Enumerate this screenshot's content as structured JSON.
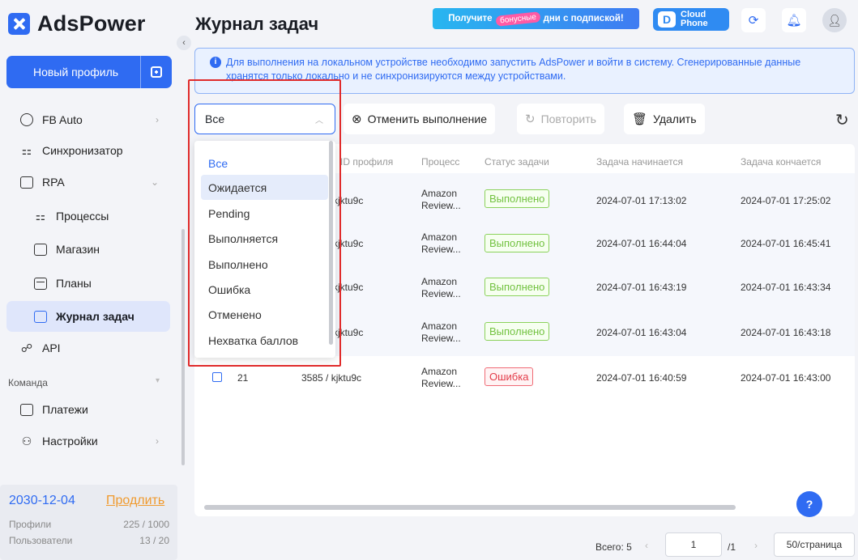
{
  "app": {
    "brand": "AdsPower"
  },
  "sidebar": {
    "new_profile": "Новый профиль",
    "items": [
      {
        "label": "FB Auto",
        "icon": "fb-auto-icon"
      },
      {
        "label": "Синхронизатор",
        "icon": "sync-icon"
      },
      {
        "label": "RPA",
        "icon": "robot-icon"
      },
      {
        "label": "Процессы",
        "icon": "flow-icon"
      },
      {
        "label": "Магазин",
        "icon": "shop-icon"
      },
      {
        "label": "Планы",
        "icon": "calendar-icon"
      },
      {
        "label": "Журнал задач",
        "icon": "task-log-icon"
      },
      {
        "label": "API",
        "icon": "api-icon"
      },
      {
        "label": "Платежи",
        "icon": "payment-icon"
      },
      {
        "label": "Настройки",
        "icon": "team-settings-icon"
      }
    ],
    "group_label": "Команда",
    "footer": {
      "expiry": "2030-12-04",
      "renew": "Продлить",
      "profiles_label": "Профили",
      "profiles_value": "225 / 1000",
      "users_label": "Пользователи",
      "users_value": "13 / 20"
    }
  },
  "header": {
    "title": "Журнал задач",
    "promo": {
      "before": "Получите",
      "badge": "бонусные",
      "after": "дни с подпиской!"
    },
    "cloud_phone": {
      "line1": "Cloud",
      "line2": "Phone"
    }
  },
  "notice": "Для выполнения на локальном устройстве необходимо запустить AdsPower и войти в систему. Сгенерированные данные хранятся только локально и не синхронизируются между устройствами.",
  "toolbar": {
    "filter_value": "Все",
    "cancel": "Отменить выполнение",
    "retry": "Повторить",
    "delete": "Удалить"
  },
  "dropdown": {
    "options": [
      "Все",
      "Ожидается",
      "Pending",
      "Выполняется",
      "Выполнено",
      "Ошибка",
      "Отменено",
      "Нехватка баллов"
    ]
  },
  "table": {
    "headers": {
      "profile": "ID профиля",
      "process": "Процесс",
      "status": "Статус задачи",
      "start": "Задача начинается",
      "end": "Задача кончается"
    },
    "rows": [
      {
        "profile": "kjktu9c",
        "process": "Amazon Review...",
        "status": "Выполнено",
        "start": "2024-07-01 17:13:02",
        "end": "2024-07-01 17:25:02"
      },
      {
        "profile": "kjktu9c",
        "process": "Amazon Review...",
        "status": "Выполнено",
        "start": "2024-07-01 16:44:04",
        "end": "2024-07-01 16:45:41"
      },
      {
        "profile": "kjktu9c",
        "process": "Amazon Review...",
        "status": "Выполнено",
        "start": "2024-07-01 16:43:19",
        "end": "2024-07-01 16:43:34"
      },
      {
        "profile": "kjktu9c",
        "process": "Amazon Review...",
        "status": "Выполнено",
        "start": "2024-07-01 16:43:04",
        "end": "2024-07-01 16:43:18"
      },
      {
        "num": "21",
        "profile": "3585 / kjktu9c",
        "process": "Amazon Review...",
        "status": "Ошибка",
        "start": "2024-07-01 16:40:59",
        "end": "2024-07-01 16:43:00"
      }
    ]
  },
  "pagination": {
    "total": "Всего: 5",
    "page": "1",
    "of": "/1",
    "size": "50/страница"
  },
  "colors": {
    "accent": "#2f6bf2",
    "success": "#72c240",
    "error": "#e33b48",
    "highlight_frame": "#e02b2b",
    "renew": "#f09a2e"
  }
}
